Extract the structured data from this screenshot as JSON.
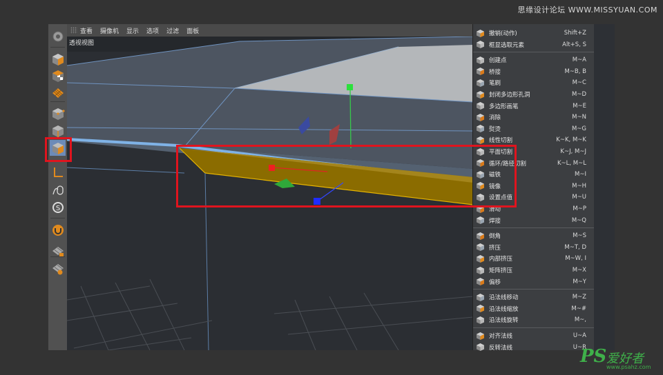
{
  "watermark_top": "思缘设计论坛 WWW.MISSYUAN.COM",
  "watermark_bottom": {
    "logo": "PS",
    "title": "爱好者",
    "url": "www.psahz.com"
  },
  "viewport": {
    "menu": [
      "查看",
      "摄像机",
      "显示",
      "选项",
      "过滤",
      "面板"
    ],
    "label": "透视视图"
  },
  "toolbar": {
    "tools": [
      {
        "icon": "settings-cog-icon",
        "active": false
      },
      {
        "icon": "cube-view-icon",
        "active": false
      },
      {
        "icon": "checker-cube-icon",
        "active": false
      },
      {
        "icon": "orange-grid-icon",
        "active": false
      },
      {
        "icon": "point-mode-cube-icon",
        "active": false
      },
      {
        "icon": "edge-mode-cube-icon",
        "active": false
      },
      {
        "icon": "polygon-mode-cube-icon",
        "active": true
      },
      {
        "icon": "axis-mode-icon",
        "active": false
      },
      {
        "icon": "tweak-mode-icon",
        "active": false
      },
      {
        "icon": "snap-icon",
        "active": false
      },
      {
        "icon": "magnet-icon",
        "active": false
      },
      {
        "icon": "workplane-lock-icon",
        "active": false
      },
      {
        "icon": "workplane-grid-icon",
        "active": false
      }
    ]
  },
  "context_menu": {
    "groups": [
      [
        {
          "label": "撤销(动作)",
          "shortcut": "Shift+Z",
          "icon": "undo-icon"
        },
        {
          "label": "框显选取元素",
          "shortcut": "Alt+S, S",
          "icon": "frame-selected-icon"
        }
      ],
      [
        {
          "label": "创建点",
          "shortcut": "M~A",
          "icon": "create-point-icon"
        },
        {
          "label": "桥接",
          "shortcut": "M~B, B",
          "icon": "bridge-icon"
        },
        {
          "label": "笔刷",
          "shortcut": "M~C",
          "icon": "brush-icon"
        },
        {
          "label": "封闭多边形孔洞",
          "shortcut": "M~D",
          "icon": "close-hole-icon"
        },
        {
          "label": "多边形画笔",
          "shortcut": "M~E",
          "icon": "polygon-pen-icon"
        },
        {
          "label": "消除",
          "shortcut": "M~N",
          "icon": "dissolve-icon"
        },
        {
          "label": "熨烫",
          "shortcut": "M~G",
          "icon": "iron-icon"
        },
        {
          "label": "线性切割",
          "shortcut": "K~K, M~K",
          "icon": "line-cut-icon"
        },
        {
          "label": "平面切割",
          "shortcut": "K~J, M~J",
          "icon": "plane-cut-icon"
        },
        {
          "label": "循环/路径切割",
          "shortcut": "K~L, M~L",
          "icon": "loop-cut-icon"
        },
        {
          "label": "磁铁",
          "shortcut": "M~I",
          "icon": "magnet-icon"
        },
        {
          "label": "镜像",
          "shortcut": "M~H",
          "icon": "mirror-icon"
        },
        {
          "label": "设置点值",
          "shortcut": "M~U",
          "icon": "set-point-value-icon"
        },
        {
          "label": "滑动",
          "shortcut": "M~P",
          "icon": "slide-icon"
        },
        {
          "label": "焊接",
          "shortcut": "M~Q",
          "icon": "weld-icon"
        }
      ],
      [
        {
          "label": "倒角",
          "shortcut": "M~S",
          "icon": "bevel-icon"
        },
        {
          "label": "挤压",
          "shortcut": "M~T, D",
          "icon": "extrude-icon"
        },
        {
          "label": "内部挤压",
          "shortcut": "M~W, I",
          "icon": "extrude-inner-icon"
        },
        {
          "label": "矩阵挤压",
          "shortcut": "M~X",
          "icon": "matrix-extrude-icon"
        },
        {
          "label": "偏移",
          "shortcut": "M~Y",
          "icon": "offset-icon"
        }
      ],
      [
        {
          "label": "沿法线移动",
          "shortcut": "M~Z",
          "icon": "normal-move-icon"
        },
        {
          "label": "沿法线缩放",
          "shortcut": "M~#",
          "icon": "normal-scale-icon"
        },
        {
          "label": "沿法线旋转",
          "shortcut": "M~,",
          "icon": "normal-rotate-icon"
        }
      ],
      [
        {
          "label": "对齐法线",
          "shortcut": "U~A",
          "icon": "align-normals-icon"
        },
        {
          "label": "反转法线",
          "shortcut": "U~R",
          "icon": "reverse-normals-icon"
        }
      ]
    ]
  },
  "colors": {
    "highlight_frame": "#e0141e",
    "selected_polygon": "#8a6d00",
    "active_tool": "#6d8bb8",
    "edge_blue": "#6ea3d8"
  }
}
